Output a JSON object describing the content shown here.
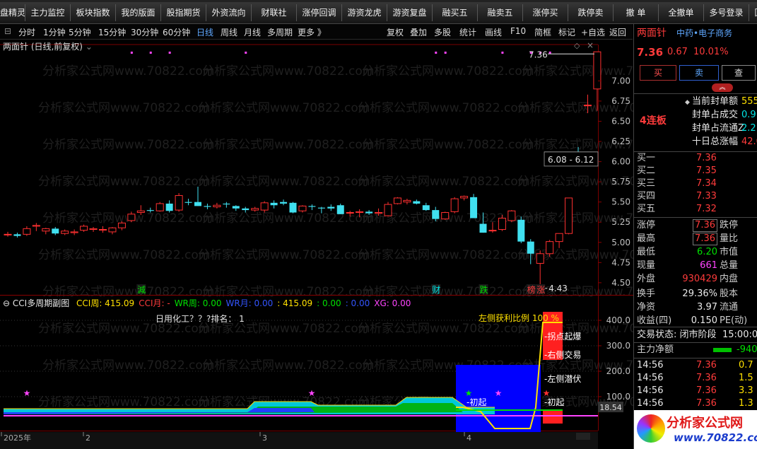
{
  "toolbar": {
    "items": [
      "盘精灵",
      "主力监控",
      "板块指数",
      "我的版面",
      "股指期货",
      "外资流向",
      "财联社",
      "涨停回调",
      "游资龙虎",
      "游资复盘",
      "融买五",
      "融卖五",
      "涨停买",
      "跌停卖",
      "撤 单",
      "全撤单",
      "多号登录",
      "回"
    ]
  },
  "period_bar": {
    "left": [
      "分时",
      "1分钟",
      "5分钟",
      "15分钟",
      "30分钟",
      "60分钟",
      "日线",
      "周线",
      "月线",
      "多周期",
      "更多 》"
    ],
    "active": "日线",
    "right": [
      "复权",
      "叠加",
      "多股",
      "统计",
      "画线",
      "F10",
      "简框",
      "标记",
      "+自选",
      "返回"
    ]
  },
  "main_chart": {
    "title": "两面针 (日线,前复权)",
    "watermark": "分析家公式网www.70822.com",
    "y_ticks": [
      "7.00",
      "6.75",
      "6.50",
      "6.25",
      "6.00",
      "5.75",
      "5.50",
      "5.25",
      "5.00",
      "4.75",
      "4.50"
    ],
    "high_label": "7.36",
    "low_label": "4.43",
    "box_label": "6.08 - 6.12",
    "markers": [
      {
        "text": "減",
        "color": "#00e000",
        "day": 14
      },
      {
        "text": "财",
        "color": "#00e6e6",
        "day": 45
      },
      {
        "text": "跌",
        "color": "#00e000",
        "day": 50
      },
      {
        "text": "榜",
        "color": "#ff3b3b",
        "day": 55
      },
      {
        "text": "涨",
        "color": "#ff3b3b",
        "day": 56
      }
    ]
  },
  "indicator": {
    "name": "CCI多周期副图",
    "legend": [
      {
        "text": "CCI周: 415.09",
        "color": "#ffe000"
      },
      {
        "text": "CCI月: -",
        "color": "#ff3b3b"
      },
      {
        "text": "WR周: 0.00",
        "color": "#00e000"
      },
      {
        "text": "WR月: 0.00",
        "color": "#3355ff"
      },
      {
        "text": ": 415.09",
        "color": "#ffe000"
      },
      {
        "text": ": 0.00",
        "color": "#00e000"
      },
      {
        "text": ": 0.00",
        "color": "#3355ff"
      },
      {
        "text": "XG: 0.00",
        "color": "#ff44ff"
      }
    ],
    "sector_text": "日用化工？？?排名： 1",
    "profit_text": "左侧获利比例 100 %",
    "labels": [
      "拐点起爆",
      "右侧交易",
      "左侧潜伏",
      "初起",
      "初起"
    ],
    "y_ticks": [
      "400.0",
      "300.0",
      "200.0",
      "100.0"
    ],
    "current_value": "18.54"
  },
  "time_axis": {
    "labels": [
      "2025年",
      "2",
      "3",
      "4"
    ]
  },
  "quote": {
    "name": "两面针",
    "sector": "中药•电子商务",
    "price": "7.36",
    "change": "0.67",
    "pct": "10.01%",
    "buttons": [
      "买",
      "卖",
      "查"
    ],
    "streak": "4连板",
    "seal_items": [
      {
        "label": "当前封单额",
        "value": "555"
      },
      {
        "label": "封单占成交",
        "value": "0.9"
      },
      {
        "label": "封单占流通Z",
        "value": "2.2"
      },
      {
        "label": "十日总涨幅",
        "value": "42.0"
      }
    ],
    "bids": [
      {
        "label": "买一",
        "price": "7.36"
      },
      {
        "label": "买二",
        "price": "7.35"
      },
      {
        "label": "买三",
        "price": "7.34"
      },
      {
        "label": "买四",
        "price": "7.33"
      },
      {
        "label": "买五",
        "price": "7.32"
      }
    ],
    "stats": [
      {
        "l": "涨停",
        "v": "7.36",
        "vc": "red",
        "r": "跌停"
      },
      {
        "l": "最高",
        "v": "7.36",
        "vc": "red",
        "r": "量比"
      },
      {
        "l": "最低",
        "v": "6.20",
        "vc": "green",
        "r": "市值"
      },
      {
        "l": "现量",
        "v": "661",
        "vc": "mag",
        "r": "总量"
      },
      {
        "l": "外盘",
        "v": "930429",
        "vc": "red",
        "r": "内盘"
      },
      {
        "l": "换手",
        "v": "29.36%",
        "vc": "white",
        "r": "股本"
      },
      {
        "l": "净资",
        "v": "3.97",
        "vc": "white",
        "r": "流通"
      },
      {
        "l": "收益(四)",
        "v": "0.150",
        "vc": "white",
        "r": "PE(动)"
      }
    ],
    "status_label": "交易状态: 闭市阶段",
    "status_time": "15:00:0",
    "net_label": "主力净额",
    "net_value": "-940",
    "ticks": [
      {
        "t": "14:56",
        "p": "7.36",
        "v": "0.7"
      },
      {
        "t": "14:56",
        "p": "7.36",
        "v": "1.5"
      },
      {
        "t": "14:56",
        "p": "7.36",
        "v": "3.3"
      },
      {
        "t": "14:56",
        "p": "7.36",
        "v": "1.3"
      }
    ],
    "brand": "分析家公式网",
    "brand_url": "www.70822.com"
  },
  "chart_data": {
    "type": "candlestick",
    "y_range": [
      4.35,
      7.45
    ],
    "candles": [
      [
        5.1,
        5.13,
        5.07,
        5.1
      ],
      [
        5.1,
        5.12,
        5.06,
        5.08
      ],
      [
        5.1,
        5.2,
        5.08,
        5.17
      ],
      [
        5.2,
        5.24,
        5.14,
        5.21
      ],
      [
        5.14,
        5.18,
        5.1,
        5.17
      ],
      [
        5.17,
        5.19,
        5.09,
        5.11
      ],
      [
        5.11,
        5.16,
        5.09,
        5.14
      ],
      [
        5.12,
        5.16,
        5.09,
        5.13
      ],
      [
        5.15,
        5.22,
        5.13,
        5.2
      ],
      [
        5.16,
        5.19,
        5.13,
        5.17
      ],
      [
        5.16,
        5.2,
        5.12,
        5.16
      ],
      [
        5.13,
        5.19,
        5.1,
        5.18
      ],
      [
        5.18,
        5.26,
        5.15,
        5.24
      ],
      [
        5.27,
        5.38,
        5.25,
        5.35
      ],
      [
        5.37,
        5.46,
        5.34,
        5.39
      ],
      [
        5.4,
        5.43,
        5.37,
        5.39
      ],
      [
        5.39,
        5.5,
        5.38,
        5.48
      ],
      [
        5.48,
        5.52,
        5.37,
        5.39
      ],
      [
        5.4,
        5.61,
        5.38,
        5.58
      ],
      [
        5.5,
        5.54,
        5.46,
        5.49
      ],
      [
        5.5,
        5.69,
        5.45,
        5.45
      ],
      [
        5.45,
        5.48,
        5.41,
        5.44
      ],
      [
        5.44,
        5.49,
        5.42,
        5.46
      ],
      [
        5.48,
        5.5,
        5.43,
        5.47
      ],
      [
        5.45,
        5.46,
        5.39,
        5.42
      ],
      [
        5.42,
        5.44,
        5.37,
        5.4
      ],
      [
        5.4,
        5.44,
        5.38,
        5.42
      ],
      [
        5.4,
        5.51,
        5.37,
        5.49
      ],
      [
        5.49,
        5.52,
        5.42,
        5.46
      ],
      [
        5.5,
        5.53,
        5.46,
        5.48
      ],
      [
        5.49,
        5.5,
        5.36,
        5.37
      ],
      [
        5.39,
        5.46,
        5.37,
        5.45
      ],
      [
        5.45,
        5.47,
        5.4,
        5.44
      ],
      [
        5.43,
        5.44,
        5.36,
        5.42
      ],
      [
        5.44,
        5.47,
        5.39,
        5.42
      ],
      [
        5.46,
        5.48,
        5.35,
        5.35
      ],
      [
        5.37,
        5.39,
        5.32,
        5.37
      ],
      [
        5.37,
        5.41,
        5.31,
        5.38
      ],
      [
        5.38,
        5.4,
        5.34,
        5.36
      ],
      [
        5.36,
        5.42,
        5.33,
        5.37
      ],
      [
        5.33,
        5.5,
        5.32,
        5.47
      ],
      [
        5.48,
        5.56,
        5.47,
        5.55
      ],
      [
        5.5,
        5.54,
        5.47,
        5.52
      ],
      [
        5.51,
        5.53,
        5.47,
        5.48
      ],
      [
        5.46,
        5.49,
        5.39,
        5.4
      ],
      [
        5.4,
        5.44,
        5.26,
        5.29
      ],
      [
        5.29,
        5.38,
        5.28,
        5.37
      ],
      [
        5.38,
        5.56,
        5.36,
        5.54
      ],
      [
        5.55,
        5.58,
        5.52,
        5.57
      ],
      [
        5.56,
        5.6,
        5.3,
        5.3
      ],
      [
        5.23,
        5.37,
        5.12,
        5.12
      ],
      [
        5.15,
        5.25,
        5.12,
        5.15
      ],
      [
        5.16,
        5.34,
        5.14,
        5.3
      ],
      [
        5.27,
        5.4,
        5.25,
        5.39
      ],
      [
        5.28,
        5.32,
        4.99,
        5.01
      ],
      [
        5.01,
        5.04,
        4.73,
        4.86
      ],
      [
        4.74,
        4.9,
        4.43,
        4.86
      ],
      [
        4.86,
        5.03,
        4.82,
        5.01
      ],
      [
        5.01,
        5.11,
        4.93,
        5.11
      ],
      [
        5.11,
        5.55,
        5.1,
        5.55
      ],
      [
        6.12,
        6.18,
        5.96,
        6.08
      ],
      [
        6.7,
        6.83,
        6.6,
        6.7
      ],
      [
        6.9,
        7.36,
        6.63,
        7.36
      ]
    ]
  }
}
